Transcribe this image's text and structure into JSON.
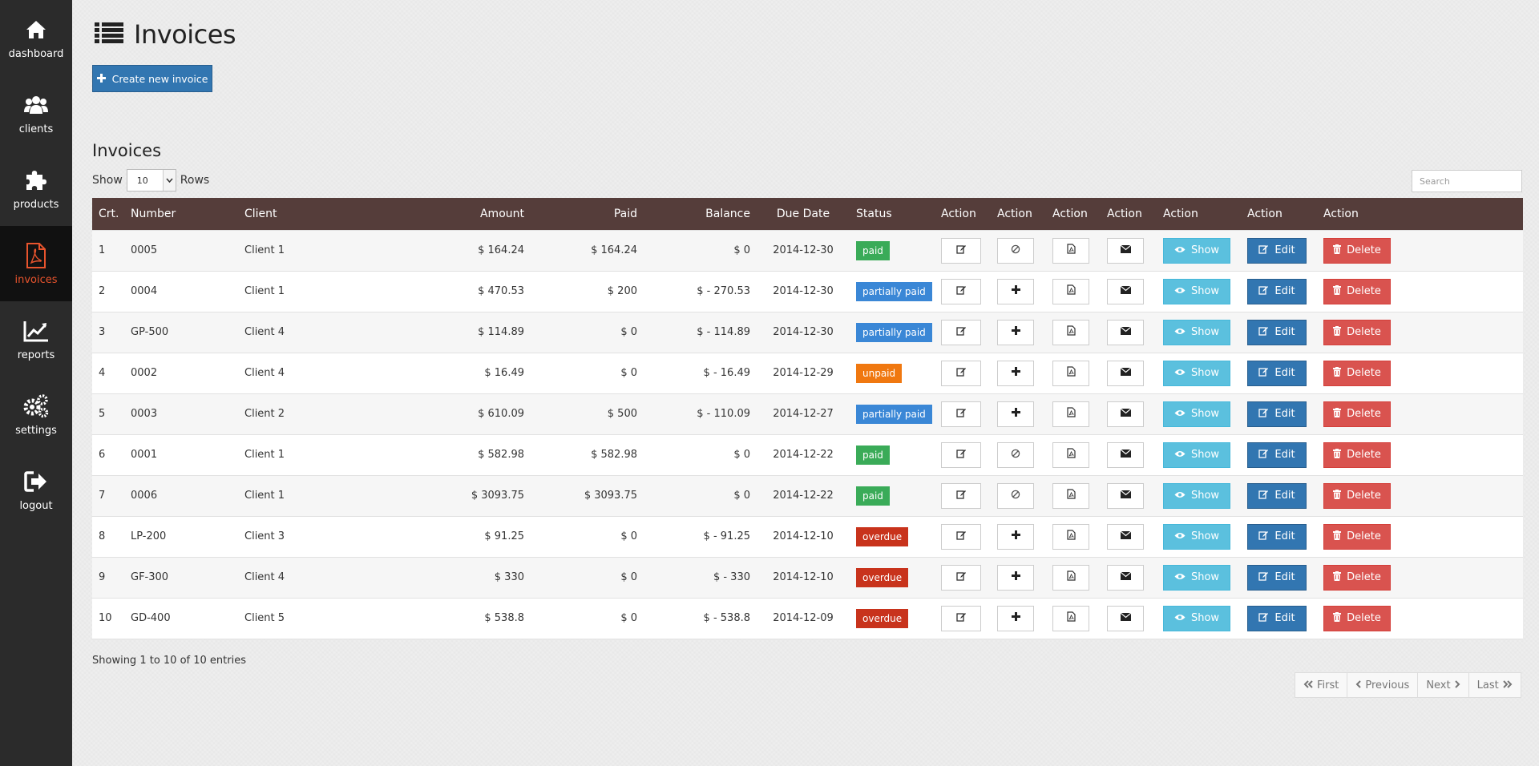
{
  "sidebar": {
    "items": [
      {
        "label": "dashboard",
        "icon": "home-icon"
      },
      {
        "label": "clients",
        "icon": "users-icon"
      },
      {
        "label": "products",
        "icon": "puzzle-icon"
      },
      {
        "label": "invoices",
        "icon": "file-pdf-icon",
        "active": true
      },
      {
        "label": "reports",
        "icon": "chart-line-icon"
      },
      {
        "label": "settings",
        "icon": "gears-icon"
      },
      {
        "label": "logout",
        "icon": "sign-out-icon"
      }
    ]
  },
  "header": {
    "title": "Invoices",
    "icon": "list-icon"
  },
  "toolbar": {
    "create_label": "Create new invoice"
  },
  "section": {
    "title": "Invoices"
  },
  "length_control": {
    "show_label": "Show",
    "rows_label": "Rows",
    "selected": "10"
  },
  "search": {
    "placeholder": "Search"
  },
  "table": {
    "columns": {
      "crt": "Crt.",
      "number": "Number",
      "client": "Client",
      "amount": "Amount",
      "paid": "Paid",
      "balance": "Balance",
      "due_date": "Due Date",
      "status": "Status",
      "action": "Action"
    },
    "action_labels": {
      "show": "Show",
      "edit": "Edit",
      "delete": "Delete"
    },
    "rows": [
      {
        "crt": "1",
        "number": "0005",
        "client": "Client 1",
        "amount": "$ 164.24",
        "paid": "$ 164.24",
        "balance": "$ 0",
        "due_date": "2014-12-30",
        "status": "paid",
        "status_type": "paid",
        "can_add_payment": false
      },
      {
        "crt": "2",
        "number": "0004",
        "client": "Client 1",
        "amount": "$ 470.53",
        "paid": "$ 200",
        "balance": "$ - 270.53",
        "due_date": "2014-12-30",
        "status": "partially paid",
        "status_type": "partially",
        "can_add_payment": true
      },
      {
        "crt": "3",
        "number": "GP-500",
        "client": "Client 4",
        "amount": "$ 114.89",
        "paid": "$ 0",
        "balance": "$ - 114.89",
        "due_date": "2014-12-30",
        "status": "partially paid",
        "status_type": "partially",
        "can_add_payment": true
      },
      {
        "crt": "4",
        "number": "0002",
        "client": "Client 4",
        "amount": "$ 16.49",
        "paid": "$ 0",
        "balance": "$ - 16.49",
        "due_date": "2014-12-29",
        "status": "unpaid",
        "status_type": "unpaid",
        "can_add_payment": true
      },
      {
        "crt": "5",
        "number": "0003",
        "client": "Client 2",
        "amount": "$ 610.09",
        "paid": "$ 500",
        "balance": "$ - 110.09",
        "due_date": "2014-12-27",
        "status": "partially paid",
        "status_type": "partially",
        "can_add_payment": true
      },
      {
        "crt": "6",
        "number": "0001",
        "client": "Client 1",
        "amount": "$ 582.98",
        "paid": "$ 582.98",
        "balance": "$ 0",
        "due_date": "2014-12-22",
        "status": "paid",
        "status_type": "paid",
        "can_add_payment": false
      },
      {
        "crt": "7",
        "number": "0006",
        "client": "Client 1",
        "amount": "$ 3093.75",
        "paid": "$ 3093.75",
        "balance": "$ 0",
        "due_date": "2014-12-22",
        "status": "paid",
        "status_type": "paid",
        "can_add_payment": false
      },
      {
        "crt": "8",
        "number": "LP-200",
        "client": "Client 3",
        "amount": "$ 91.25",
        "paid": "$ 0",
        "balance": "$ - 91.25",
        "due_date": "2014-12-10",
        "status": "overdue",
        "status_type": "overdue",
        "can_add_payment": true
      },
      {
        "crt": "9",
        "number": "GF-300",
        "client": "Client 4",
        "amount": "$ 330",
        "paid": "$ 0",
        "balance": "$ - 330",
        "due_date": "2014-12-10",
        "status": "overdue",
        "status_type": "overdue",
        "can_add_payment": true
      },
      {
        "crt": "10",
        "number": "GD-400",
        "client": "Client 5",
        "amount": "$ 538.8",
        "paid": "$ 0",
        "balance": "$ - 538.8",
        "due_date": "2014-12-09",
        "status": "overdue",
        "status_type": "overdue",
        "can_add_payment": true
      }
    ]
  },
  "footer": {
    "entries_info": "Showing 1 to 10 of 10 entries"
  },
  "pagination": {
    "first": "First",
    "previous": "Previous",
    "next": "Next",
    "last": "Last"
  },
  "colors": {
    "sidebar_bg": "#2b2b2b",
    "active_accent": "#e8542d",
    "table_header": "#553d3a",
    "primary": "#3276b1",
    "info": "#5bc0de",
    "danger": "#d9534f",
    "paid": "#3aab58",
    "partially_paid": "#3a87d6",
    "unpaid": "#f07810",
    "overdue": "#c8331c"
  }
}
